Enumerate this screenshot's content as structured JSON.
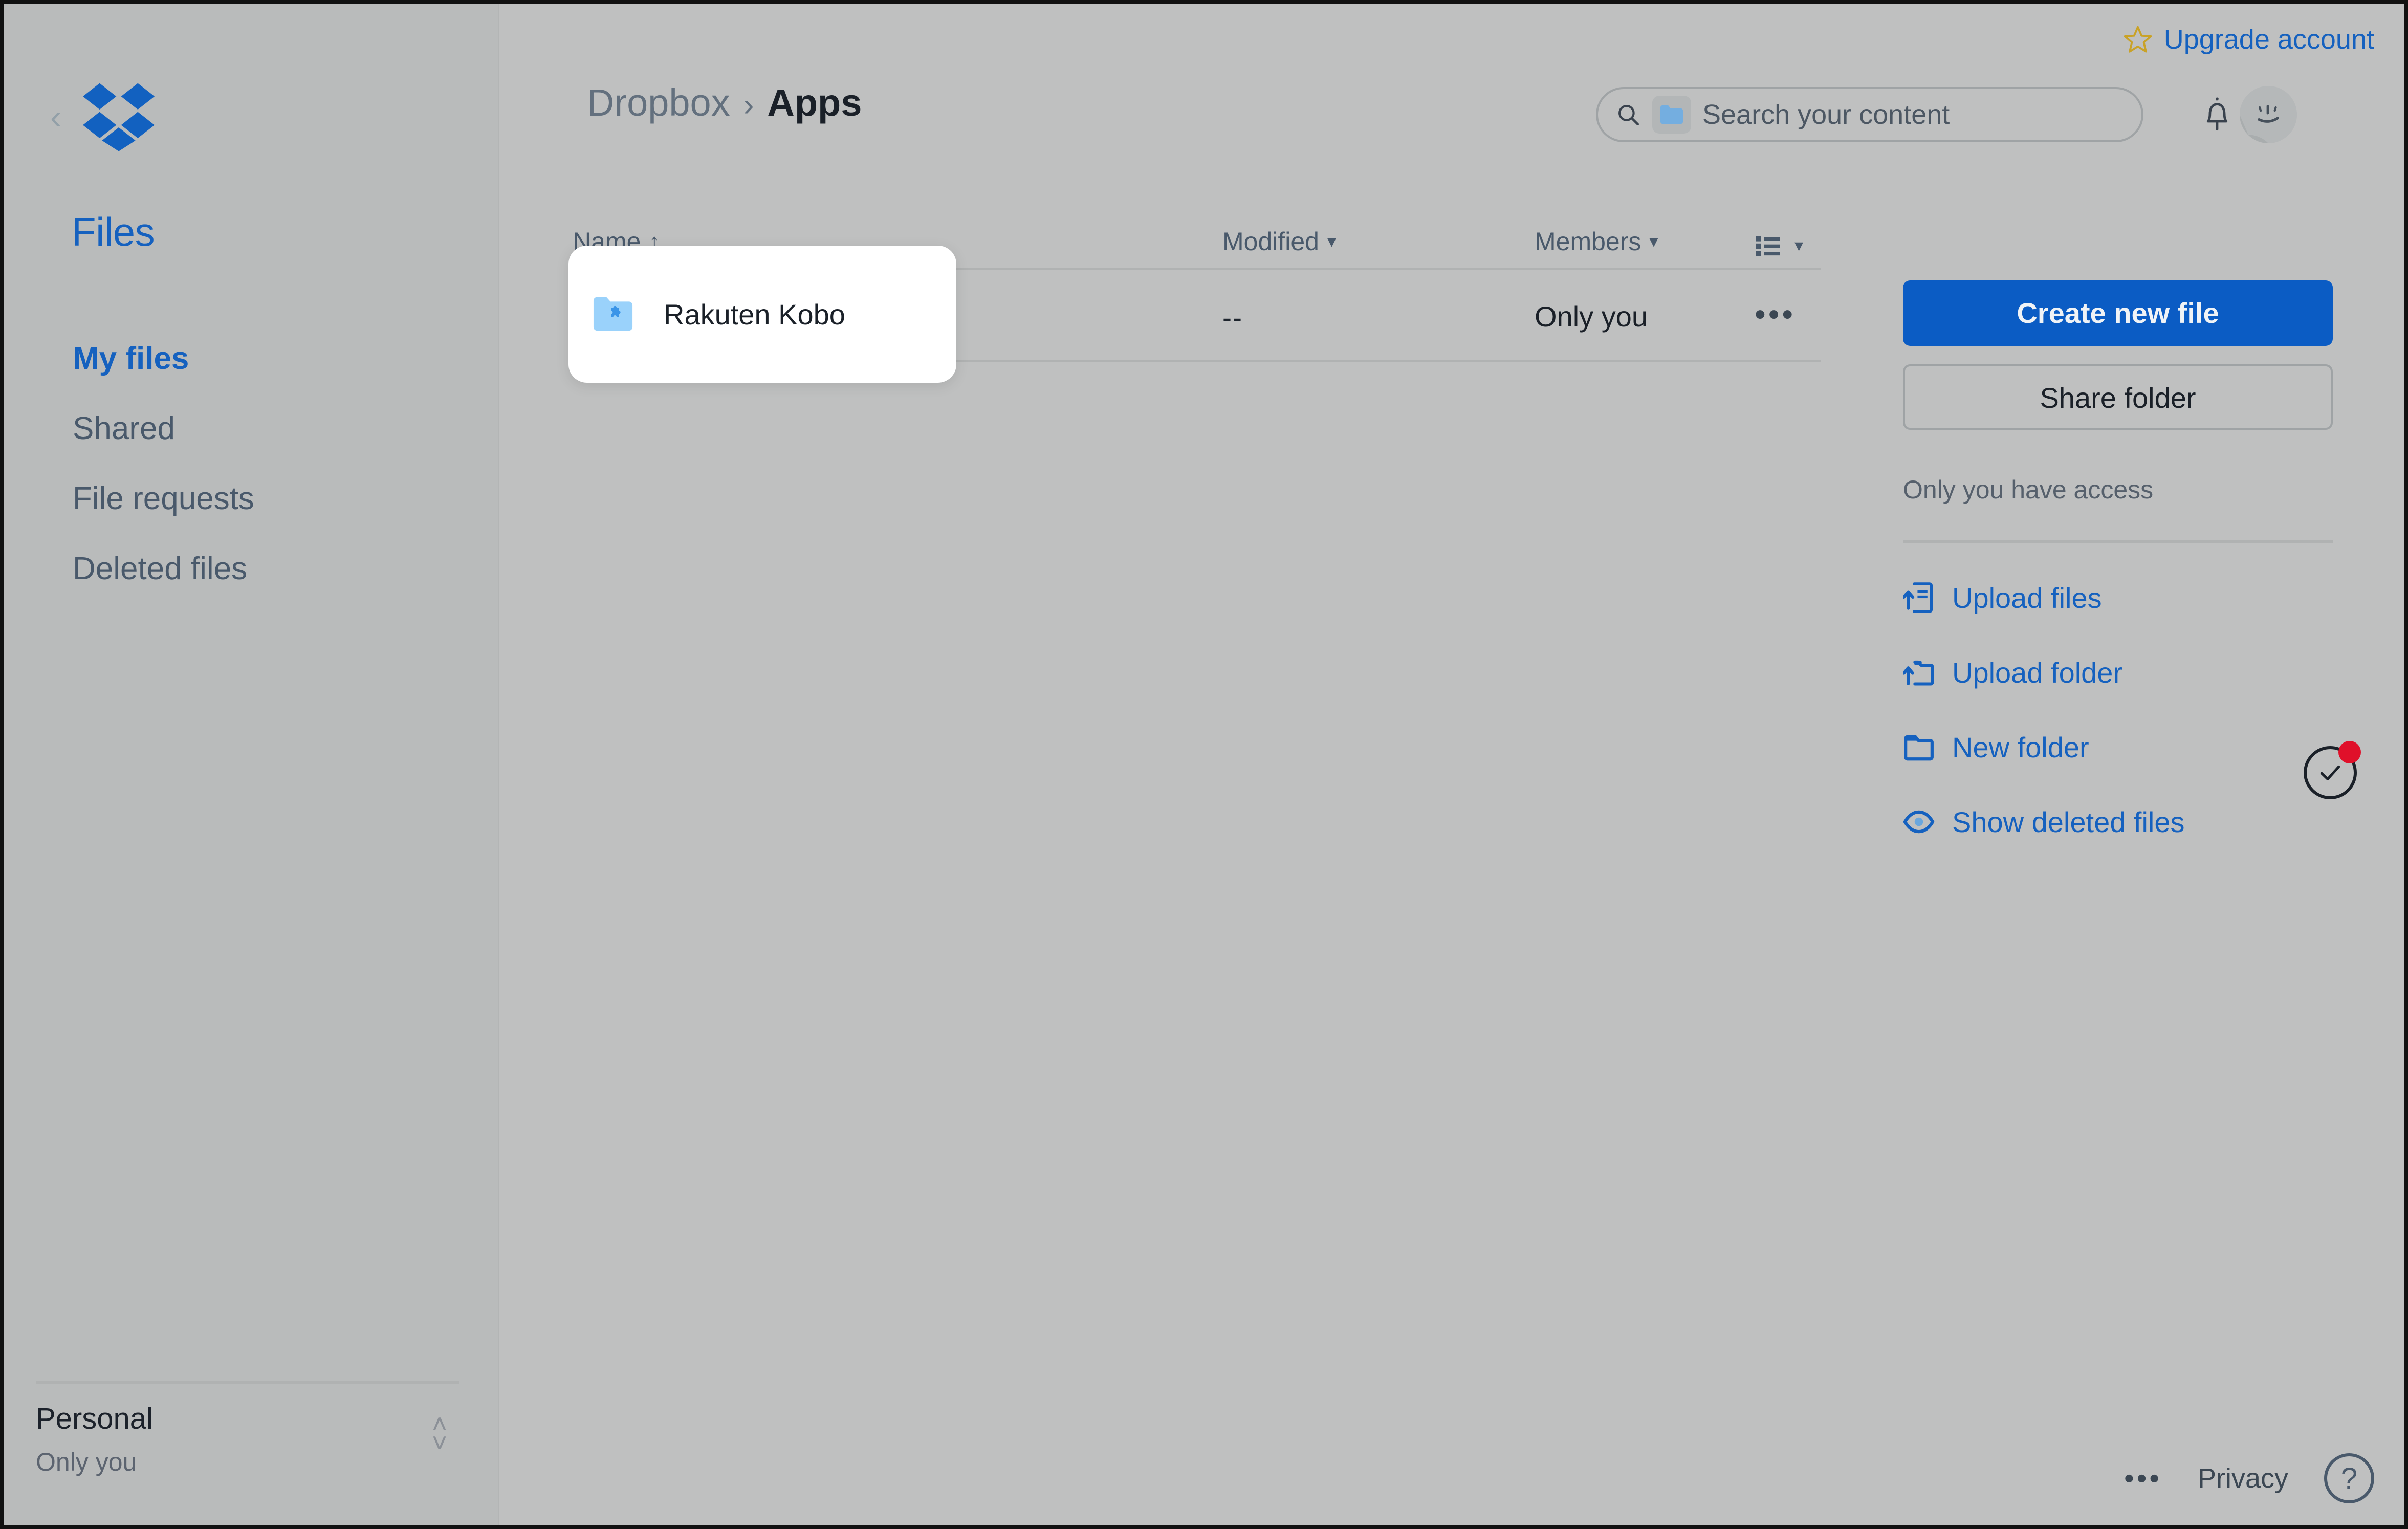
{
  "colors": {
    "app_bg": "#bfc0c0",
    "sidebar_bg": "#b9bbbb",
    "accent_blue": "#1561bf",
    "primary_button": "#0b5cc4",
    "text_dark": "#1a2028",
    "text_muted": "#49596b",
    "folder_icon": "#9ad2fb",
    "badge_red": "#e0102a",
    "star_gold": "#c9a227"
  },
  "sidebar": {
    "collapse_icon": "chevron-left-icon",
    "logo_icon": "dropbox-logo-icon",
    "title": "Files",
    "items": [
      {
        "label": "My files",
        "active": true
      },
      {
        "label": "Shared",
        "active": false
      },
      {
        "label": "File requests",
        "active": false
      },
      {
        "label": "Deleted files",
        "active": false
      }
    ],
    "account": {
      "name": "Personal",
      "subtitle": "Only you",
      "caret_up": "˄",
      "caret_down": "˅"
    }
  },
  "header": {
    "upgrade": {
      "icon": "star-icon",
      "label": "Upgrade account"
    },
    "breadcrumb": {
      "root": "Dropbox",
      "separator": "›",
      "current": "Apps"
    },
    "search": {
      "icon": "search-icon",
      "scope_icon": "folder-icon",
      "placeholder": "Search your content",
      "value": ""
    },
    "notifications_icon": "bell-icon",
    "avatar_icon": "avatar-face-icon"
  },
  "table": {
    "columns": [
      {
        "key": "name",
        "label": "Name",
        "sort": "↑"
      },
      {
        "key": "modified",
        "label": "Modified",
        "sort": "▾"
      },
      {
        "key": "members",
        "label": "Members",
        "sort": "▾"
      }
    ],
    "view_toggle": {
      "icon": "list-view-icon",
      "caret": "▾"
    },
    "rows": [
      {
        "icon": "app-folder-icon",
        "name": "Rakuten Kobo",
        "modified": "--",
        "members": "Only you",
        "overflow": "•••",
        "selected": true
      }
    ]
  },
  "right_panel": {
    "create_button": "Create new file",
    "share_button": "Share folder",
    "access_note": "Only you have access",
    "actions": [
      {
        "icon": "upload-file-icon",
        "label": "Upload files"
      },
      {
        "icon": "upload-folder-icon",
        "label": "Upload folder"
      },
      {
        "icon": "new-folder-icon",
        "label": "New folder"
      },
      {
        "icon": "eye-icon",
        "label": "Show deleted files"
      }
    ]
  },
  "sync_badge": {
    "icon": "check-circle-icon",
    "has_notification": true
  },
  "footer": {
    "more": "•••",
    "privacy": "Privacy",
    "help": "?"
  }
}
